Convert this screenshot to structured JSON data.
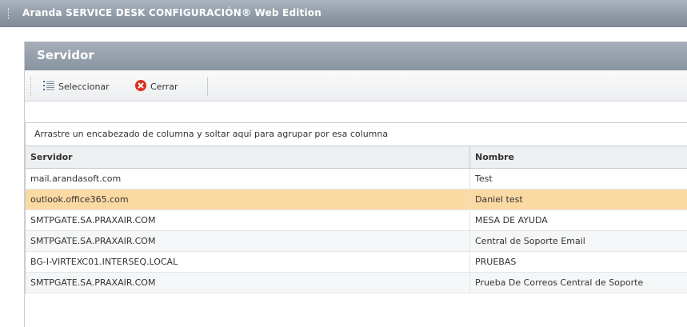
{
  "app": {
    "title": "Aranda SERVICE DESK CONFIGURACIÓN® Web Edition"
  },
  "window": {
    "title": "Servidor"
  },
  "toolbar": {
    "select_label": "Seleccionar",
    "close_label": "Cerrar"
  },
  "grid": {
    "group_hint": "Arrastre un encabezado de columna y soltar aquí para agrupar por esa columna",
    "columns": [
      "Servidor",
      "Nombre"
    ],
    "rows": [
      {
        "servidor": "mail.arandasoft.com",
        "nombre": "Test"
      },
      {
        "servidor": "outlook.office365.com",
        "nombre": "Daniel test"
      },
      {
        "servidor": "SMTPGATE.SA.PRAXAIR.COM",
        "nombre": "MESA DE AYUDA"
      },
      {
        "servidor": "SMTPGATE.SA.PRAXAIR.COM",
        "nombre": "Central de Soporte Email"
      },
      {
        "servidor": "BG-I-VIRTEXC01.INTERSEQ.LOCAL",
        "nombre": "PRUEBAS"
      },
      {
        "servidor": "SMTPGATE.SA.PRAXAIR.COM",
        "nombre": "Prueba De Correos Central de Soporte"
      }
    ],
    "selected_row": 1
  },
  "icons": {
    "select": "list-icon",
    "close": "close-circle-icon"
  },
  "colors": {
    "selected_row": "#fbd9a3",
    "close_icon": "#d9301f",
    "list_icon": "#3a6fb0"
  }
}
